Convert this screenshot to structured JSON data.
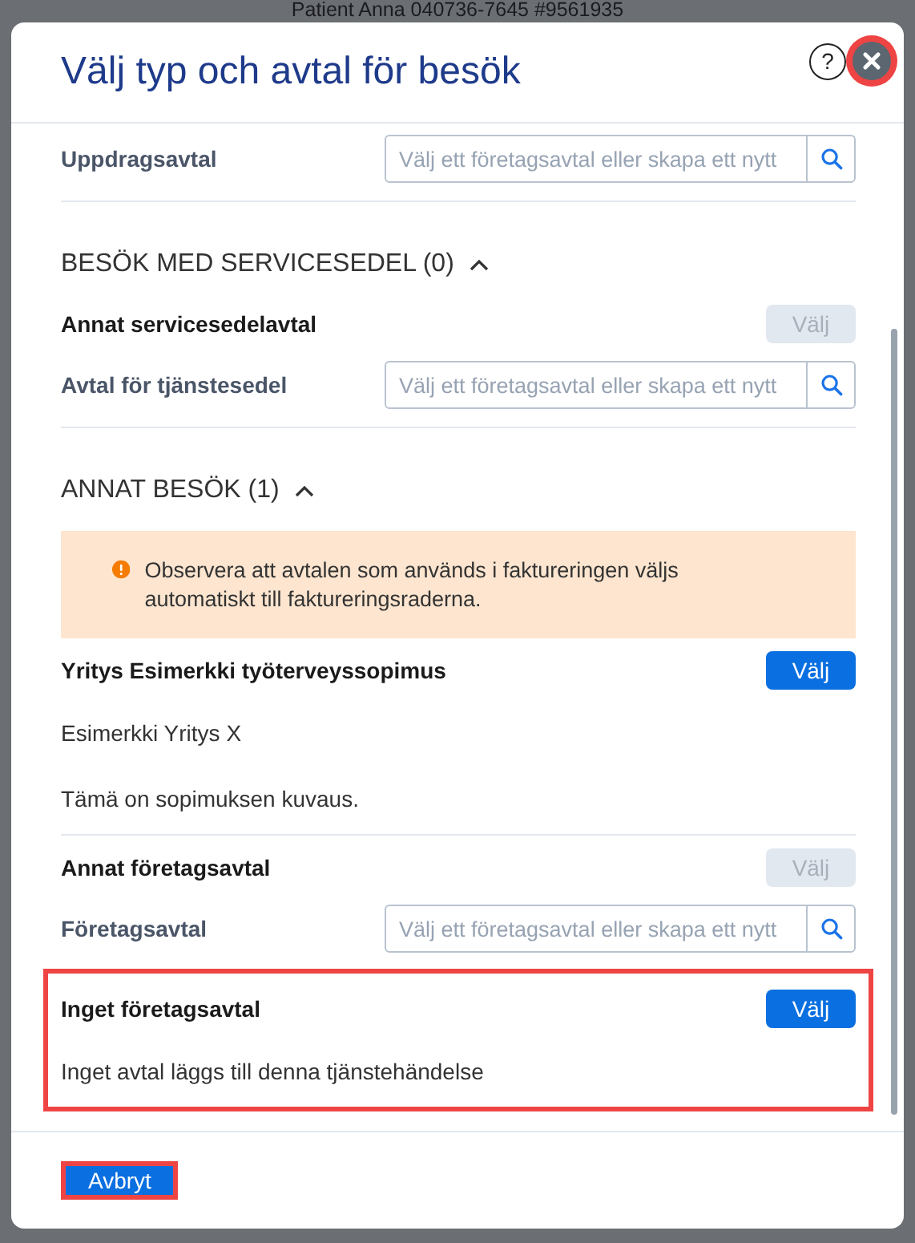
{
  "background": {
    "header_text": "Patient Anna 040736-7645 #9561935"
  },
  "dialog": {
    "title": "Välj typ och avtal för besök",
    "help_button": "?",
    "close_highlighted": true
  },
  "rows": [
    {
      "kind": "field",
      "label": "Uppdragsavtal",
      "placeholder": "Välj ett företagsavtal eller skapa ett nytt"
    },
    {
      "kind": "separator"
    },
    {
      "kind": "section",
      "title": "BESÖK MED SERVICESEDEL (0)",
      "expanded": true
    },
    {
      "kind": "option",
      "title": "Annat servicesedelavtal",
      "button": "Välj",
      "disabled": true,
      "details": [],
      "highlighted": false
    },
    {
      "kind": "field",
      "label": "Avtal för tjänstesedel",
      "placeholder": "Välj ett företagsavtal eller skapa ett nytt"
    },
    {
      "kind": "separator"
    },
    {
      "kind": "section",
      "title": "ANNAT BESÖK (1)",
      "expanded": true
    },
    {
      "kind": "notice",
      "text": "Observera att avtalen som används i faktureringen väljs automatiskt till faktureringsraderna."
    },
    {
      "kind": "option",
      "title": "Yritys Esimerkki työterveyssopimus",
      "button": "Välj",
      "disabled": false,
      "details": [
        "Esimerkki Yritys X",
        "Tämä on sopimuksen kuvaus."
      ],
      "highlighted": false
    },
    {
      "kind": "separator"
    },
    {
      "kind": "option",
      "title": "Annat företagsavtal",
      "button": "Välj",
      "disabled": true,
      "details": [],
      "highlighted": false
    },
    {
      "kind": "field",
      "label": "Företagsavtal",
      "placeholder": "Välj ett företagsavtal eller skapa ett nytt"
    },
    {
      "kind": "option",
      "title": "Inget företagsavtal",
      "button": "Välj",
      "disabled": false,
      "details": [
        "Inget avtal läggs till denna tjänstehändelse"
      ],
      "highlighted": true
    }
  ],
  "cancel_button": {
    "label": "Avbryt",
    "highlighted": true
  }
}
